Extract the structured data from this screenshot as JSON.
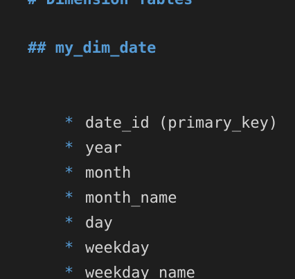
{
  "editor": {
    "heading_partial": "# Dimension Tables",
    "heading_main": "## my_dim_date",
    "bullet_marker": "*",
    "items": [
      {
        "text": "date_id (primary_key)"
      },
      {
        "text": "year"
      },
      {
        "text": "month"
      },
      {
        "text": "month_name"
      },
      {
        "text": "day"
      },
      {
        "text": "weekday"
      },
      {
        "text": "weekday_name"
      }
    ],
    "colors": {
      "background": "#1e1e1e",
      "heading": "#569cd6",
      "bullet": "#569cd6",
      "text": "#d4d4d4"
    }
  }
}
